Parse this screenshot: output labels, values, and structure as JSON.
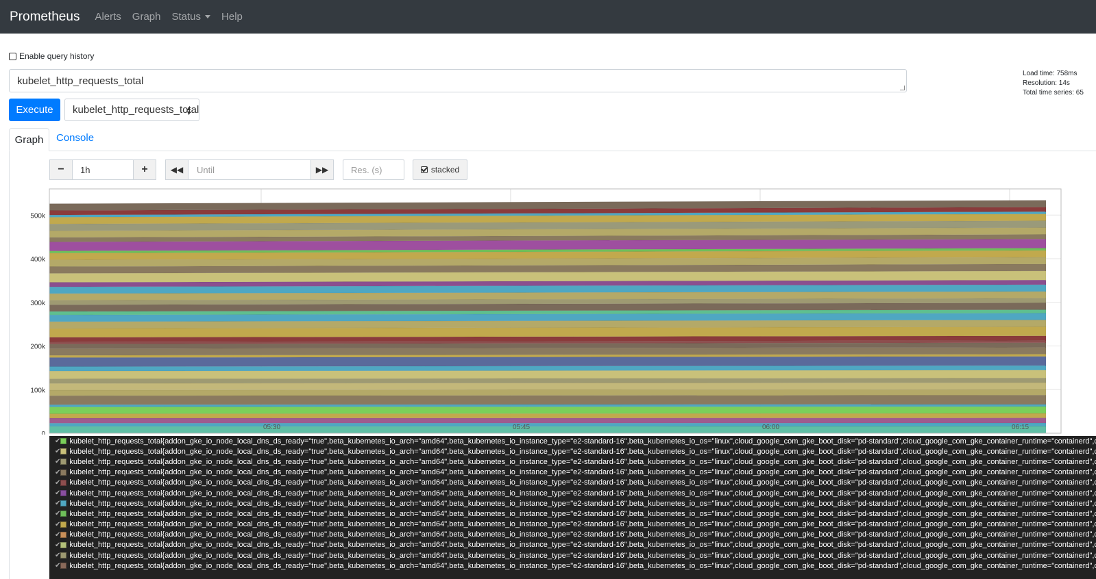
{
  "navbar": {
    "brand": "Prometheus",
    "links": [
      "Alerts",
      "Graph",
      "Status",
      "Help"
    ]
  },
  "query_history_label": "Enable query history",
  "expression": "kubelet_http_requests_total",
  "stats": {
    "load_time": "Load time: 758ms",
    "resolution": "Resolution: 14s",
    "total_series": "Total time series: 65"
  },
  "execute_label": "Execute",
  "metric_select_value": "kubelet_http_requests_total",
  "tabs": {
    "graph": "Graph",
    "console": "Console"
  },
  "controls": {
    "range_value": "1h",
    "until_placeholder": "Until",
    "res_placeholder": "Res. (s)",
    "stacked_label": "stacked"
  },
  "chart_data": {
    "type": "area",
    "stacked": true,
    "x_ticks": [
      "05:30",
      "05:45",
      "06:00",
      "06:15"
    ],
    "y_ticks": [
      "0",
      "100k",
      "200k",
      "300k",
      "400k",
      "500k"
    ],
    "ylim": [
      0,
      560000
    ],
    "series_colors": [
      "#5fbfa5",
      "#4fa7c2",
      "#9e5b8f",
      "#c1a94d",
      "#7bcf5a",
      "#4fa7c2",
      "#8a7a5f",
      "#b4a968",
      "#c3b87a",
      "#9e9a72",
      "#c9c17a",
      "#4fa7c2",
      "#5a6a9b",
      "#c1a94d",
      "#8a7a5f",
      "#7a6a5a",
      "#8d4e4e",
      "#8a3b3b",
      "#c1a94d",
      "#b4a968",
      "#4fa7c2",
      "#5fbf8f",
      "#7a6a5a",
      "#9e9a72",
      "#b4a968",
      "#4fa7c2",
      "#8a4f8f",
      "#c9c17a",
      "#8a7a5f",
      "#b4a968",
      "#c1a94d",
      "#6fbf5a",
      "#9e4f9f",
      "#8a7a5f",
      "#b4a968",
      "#9a9a7a",
      "#c1a94d",
      "#4fa7c2",
      "#8a3b3b",
      "#7a6a5a"
    ],
    "series_weights": [
      3,
      1.5,
      2.2,
      2,
      3,
      1,
      4,
      2.5,
      3,
      2,
      3.5,
      2,
      4,
      1,
      3,
      2,
      1,
      2,
      4,
      3,
      3,
      1.5,
      3,
      2,
      3,
      3,
      2,
      4,
      3,
      3,
      3,
      1,
      4,
      2,
      3,
      3,
      3,
      1,
      2,
      3
    ],
    "total_start": 526000,
    "total_end": 534000
  },
  "legend": {
    "label": "kubelet_http_requests_total{addon_gke_io_node_local_dns_ds_ready=\"true\",beta_kubernetes_io_arch=\"amd64\",beta_kubernetes_io_instance_type=\"e2-standard-16\",beta_kubernetes_io_os=\"linux\",cloud_google_com_gke_boot_disk=\"pd-standard\",cloud_google_com_gke_container_runtime=\"containerd\",cloud_google_com_gke_nodepool=\"default-pool\"}",
    "colors": [
      "#7bcf5a",
      "#c9c17a",
      "#9e9a72",
      "#8a7a5f",
      "#8d4e4e",
      "#8a4f9f",
      "#4fa7c2",
      "#6fbf5a",
      "#c1a94d",
      "#c9905a",
      "#b4c17a",
      "#9e9a72",
      "#8a6a5a"
    ]
  }
}
